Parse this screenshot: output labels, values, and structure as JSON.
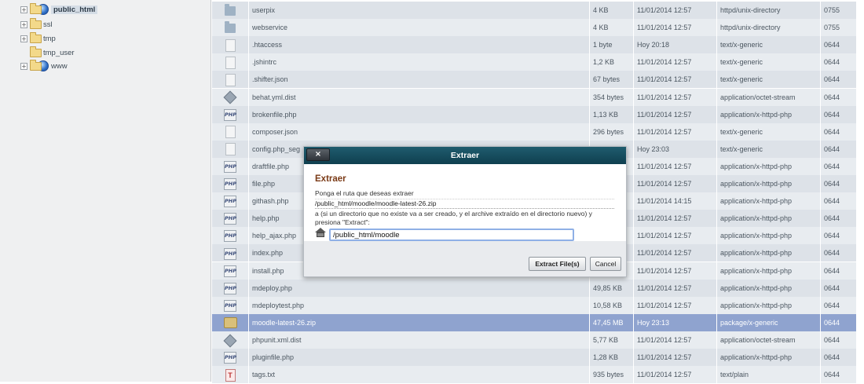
{
  "tree": [
    {
      "label": "public_html",
      "icon": "globe-folder",
      "expander": "+",
      "selected": true
    },
    {
      "label": "ssl",
      "icon": "folder",
      "expander": "+"
    },
    {
      "label": "tmp",
      "icon": "folder",
      "expander": "+"
    },
    {
      "label": "tmp_user",
      "icon": "folder",
      "expander": ""
    },
    {
      "label": "www",
      "icon": "globe-folder",
      "expander": "+"
    }
  ],
  "files": [
    {
      "name": "userpix",
      "size": "4 KB",
      "date": "11/01/2014 12:57",
      "type": "httpd/unix-directory",
      "perms": "0755",
      "icon": "folder"
    },
    {
      "name": "webservice",
      "size": "4 KB",
      "date": "11/01/2014 12:57",
      "type": "httpd/unix-directory",
      "perms": "0755",
      "icon": "folder"
    },
    {
      "name": ".htaccess",
      "size": "1 byte",
      "date": "Hoy 20:18",
      "type": "text/x-generic",
      "perms": "0644",
      "icon": "generic"
    },
    {
      "name": ".jshintrc",
      "size": "1,2 KB",
      "date": "11/01/2014 12:57",
      "type": "text/x-generic",
      "perms": "0644",
      "icon": "generic"
    },
    {
      "name": ".shifter.json",
      "size": "67 bytes",
      "date": "11/01/2014 12:57",
      "type": "text/x-generic",
      "perms": "0644",
      "icon": "generic"
    },
    {
      "name": "behat.yml.dist",
      "size": "354 bytes",
      "date": "11/01/2014 12:57",
      "type": "application/octet-stream",
      "perms": "0644",
      "icon": "binary"
    },
    {
      "name": "brokenfile.php",
      "size": "1,13 KB",
      "date": "11/01/2014 12:57",
      "type": "application/x-httpd-php",
      "perms": "0644",
      "icon": "php"
    },
    {
      "name": "composer.json",
      "size": "296 bytes",
      "date": "11/01/2014 12:57",
      "type": "text/x-generic",
      "perms": "0644",
      "icon": "generic"
    },
    {
      "name": "config.php_seg",
      "size": "",
      "date": "Hoy 23:03",
      "type": "text/x-generic",
      "perms": "0644",
      "icon": "generic"
    },
    {
      "name": "draftfile.php",
      "size": "",
      "date": "11/01/2014 12:57",
      "type": "application/x-httpd-php",
      "perms": "0644",
      "icon": "php"
    },
    {
      "name": "file.php",
      "size": "",
      "date": "11/01/2014 12:57",
      "type": "application/x-httpd-php",
      "perms": "0644",
      "icon": "php"
    },
    {
      "name": "githash.php",
      "size": "",
      "date": "11/01/2014 14:15",
      "type": "application/x-httpd-php",
      "perms": "0644",
      "icon": "php"
    },
    {
      "name": "help.php",
      "size": "",
      "date": "11/01/2014 12:57",
      "type": "application/x-httpd-php",
      "perms": "0644",
      "icon": "php"
    },
    {
      "name": "help_ajax.php",
      "size": "",
      "date": "11/01/2014 12:57",
      "type": "application/x-httpd-php",
      "perms": "0644",
      "icon": "php"
    },
    {
      "name": "index.php",
      "size": "",
      "date": "11/01/2014 12:57",
      "type": "application/x-httpd-php",
      "perms": "0644",
      "icon": "php"
    },
    {
      "name": "install.php",
      "size": "",
      "date": "11/01/2014 12:57",
      "type": "application/x-httpd-php",
      "perms": "0644",
      "icon": "php"
    },
    {
      "name": "mdeploy.php",
      "size": "49,85 KB",
      "date": "11/01/2014 12:57",
      "type": "application/x-httpd-php",
      "perms": "0644",
      "icon": "php"
    },
    {
      "name": "mdeploytest.php",
      "size": "10,58 KB",
      "date": "11/01/2014 12:57",
      "type": "application/x-httpd-php",
      "perms": "0644",
      "icon": "php"
    },
    {
      "name": "moodle-latest-26.zip",
      "size": "47,45 MB",
      "date": "Hoy 23:13",
      "type": "package/x-generic",
      "perms": "0644",
      "icon": "package",
      "selected": true
    },
    {
      "name": "phpunit.xml.dist",
      "size": "5,77 KB",
      "date": "11/01/2014 12:57",
      "type": "application/octet-stream",
      "perms": "0644",
      "icon": "binary"
    },
    {
      "name": "pluginfile.php",
      "size": "1,28 KB",
      "date": "11/01/2014 12:57",
      "type": "application/x-httpd-php",
      "perms": "0644",
      "icon": "php"
    },
    {
      "name": "tags.txt",
      "size": "935 bytes",
      "date": "11/01/2014 12:57",
      "type": "text/plain",
      "perms": "0644",
      "icon": "text"
    }
  ],
  "dialog": {
    "close_label": "×",
    "title": "Extraer",
    "heading": "Extraer",
    "prompt": "Ponga el ruta que deseas extraer",
    "source_path": "/public_html/moodle/moodle-latest-26.zip",
    "note_line1": "a (si un directorio que no existe va a ser creado, y el archive extraído en el directorio nuevo) y",
    "note_line2": "presiona \"Extract\":",
    "dest_value": "/public_html/moodle",
    "extract_button": "Extract File(s)",
    "cancel_button": "Cancel"
  },
  "icons": {
    "php_glyph": "PHP",
    "text_glyph": "T"
  },
  "colors": {
    "selected_row": "#8fa3cf",
    "dialog_titlebar": "#1f5c6e",
    "dialog_heading": "#7a3a16"
  }
}
